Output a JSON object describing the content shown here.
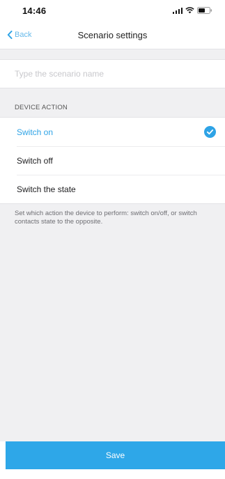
{
  "status_bar": {
    "time": "14:46",
    "icons": [
      "signal-icon",
      "wifi-icon",
      "battery-icon"
    ]
  },
  "nav": {
    "back_label": "Back",
    "title": "Scenario settings",
    "back_icon": "chevron-left-icon"
  },
  "name_field": {
    "value": "",
    "placeholder": "Type the scenario name"
  },
  "device_action": {
    "header": "DEVICE ACTION",
    "options": [
      {
        "label": "Switch on",
        "selected": true
      },
      {
        "label": "Switch off",
        "selected": false
      },
      {
        "label": "Switch the state",
        "selected": false
      }
    ],
    "selected_icon": "checkmark-circle-icon",
    "hint": "Set which action the device to perform: switch on/off, or switch contacts state to the opposite."
  },
  "save_button": {
    "label": "Save"
  },
  "colors": {
    "accent": "#2ea3e6",
    "button": "#2ea7e8",
    "background": "#f0f0f2",
    "placeholder": "#c8c8cc"
  }
}
